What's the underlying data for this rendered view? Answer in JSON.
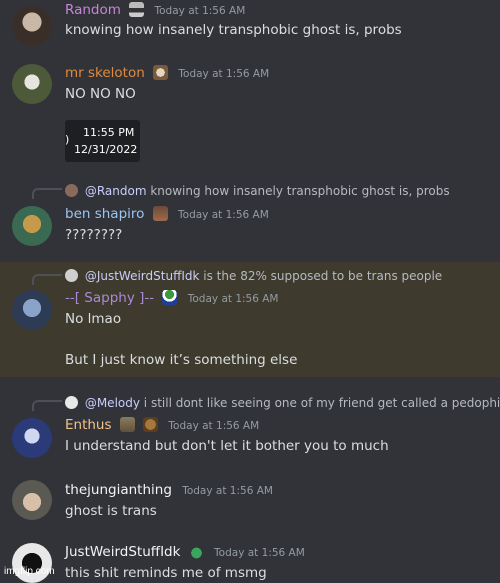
{
  "colors": {
    "background": "#313338",
    "highlight": "#3e3a2e",
    "text": "#dbdee1",
    "timestamp": "#949ba4",
    "username_random": "#c685d6",
    "username_skeleton": "#e08a3c",
    "username_ben": "#9cc4f0",
    "username_sapphy": "#a98ad6",
    "username_enthus": "#f0c38a",
    "username_default": "#f2f3f5",
    "mention": "#c9cdfb"
  },
  "messages": [
    {
      "username": "Random",
      "timestamp": "Today at 1:56 AM",
      "text": "knowing how insanely transphobic ghost is, probs"
    },
    {
      "username": "mr skeloton",
      "timestamp": "Today at 1:56 AM",
      "text": "NO NO NO",
      "embed": {
        "bracket": ")",
        "time": "11:55 PM",
        "date": "12/31/2022"
      }
    },
    {
      "reply_to": "@Random",
      "reply_text": "knowing how insanely transphobic ghost is, probs",
      "username": "ben shapiro",
      "timestamp": "Today at 1:56 AM",
      "text": "????????"
    },
    {
      "reply_to": "@JustWeirdStuffIdk",
      "reply_text": "is the 82% supposed to be trans people",
      "username": "--[ Sapphy ]--",
      "timestamp": "Today at 1:56 AM",
      "text": "No lmao",
      "text2": "But I just know it’s something else"
    },
    {
      "reply_to": "@Melody",
      "reply_text": "i still dont like seeing one of my friend get called a pedophile",
      "username": "Enthus",
      "timestamp": "Today at 1:56 AM",
      "text": "I understand but don't let it bother you to much"
    },
    {
      "username": "thejungianthing",
      "timestamp": "Today at 1:56 AM",
      "text": "ghost is trans"
    },
    {
      "username": "JustWeirdStuffIdk",
      "timestamp": "Today at 1:56 AM",
      "text": "this shit reminds me of msmg"
    }
  ],
  "watermark": "imgflip.com"
}
